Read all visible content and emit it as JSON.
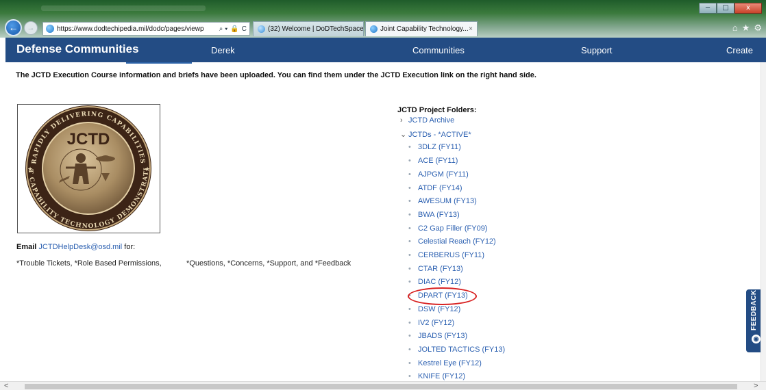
{
  "browser": {
    "url": "https://www.dodtechipedia.mil/dodc/pages/viewp",
    "url_icons": [
      "⌕ ▾",
      "🔒",
      "C"
    ],
    "tabs": [
      {
        "label": "(32) Welcome | DoDTechSpace"
      },
      {
        "label": "Joint Capability Technology...",
        "close": "×"
      }
    ],
    "window_controls": [
      "─",
      "□",
      "x"
    ],
    "toolbar_icons": [
      "⌂",
      "★",
      "⚙"
    ]
  },
  "nav": {
    "brand": "Defense Communities",
    "items": [
      "Derek",
      "Communities",
      "Support",
      "Create"
    ]
  },
  "notice": "The JCTD Execution Course information and briefs have been uploaded.  You can find them under the JCTD Execution link on the right hand side.",
  "logo": {
    "center_text": "JCTD",
    "ring_text": "RAPIDLY DELIVERING CAPABILITIES · JOINT CAPABILITY TECHNOLOGY DEMONSTRATIONS"
  },
  "contact": {
    "label": "Email",
    "email": "JCTDHelpDesk@osd.mil",
    "suffix": " for:",
    "reasons_a": "*Trouble Tickets, *Role Based Permissions,",
    "reasons_b": "*Questions, *Concerns, *Support, and *Feedback"
  },
  "folders": {
    "title": "JCTD Project Folders:",
    "top": [
      {
        "mark": "›",
        "label": "JCTD Archive"
      },
      {
        "mark": "⌄",
        "label": "JCTDs - *ACTIVE*"
      }
    ],
    "active": [
      "3DLZ (FY11)",
      "ACE (FY11)",
      "AJPGM (FY11)",
      "ATDF (FY14)",
      "AWESUM (FY13)",
      "BWA (FY13)",
      "C2 Gap Filler (FY09)",
      "Celestial Reach (FY12)",
      "CERBERUS (FY11)",
      "CTAR (FY13)",
      "DIAC (FY12)",
      "DPART (FY13)",
      "DSW (FY12)",
      "IV2 (FY12)",
      "JBADS (FY13)",
      "JOLTED TACTICS (FY13)",
      "Kestrel Eye (FY12)",
      "KNIFE (FY12)"
    ],
    "bullet": "•",
    "highlighted": "DPART (FY13)"
  },
  "feedback": {
    "label": "FEEDBACK",
    "icon": "◉"
  },
  "scrollbar": {
    "left": "<",
    "right": ">"
  },
  "colors": {
    "nav_bg": "#234c84",
    "link": "#2a5fb0",
    "highlight": "#d82020",
    "logo_bronze": "#a4865e",
    "logo_dark": "#3c2416"
  }
}
